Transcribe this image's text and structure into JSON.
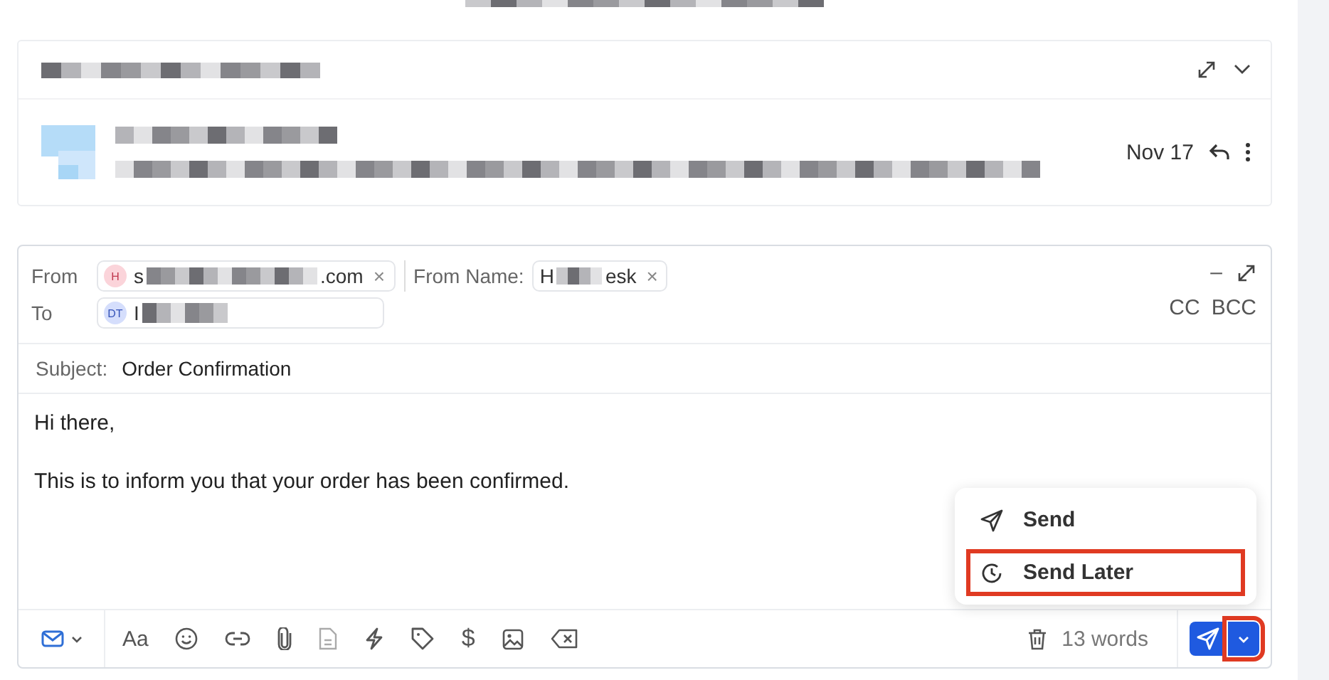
{
  "thread": {
    "date": "Nov 17"
  },
  "composer": {
    "from_label": "From",
    "from_chip": {
      "initials": "H",
      "text_start": "s",
      "text_end": ".com",
      "remove": "×"
    },
    "from_name_label": "From Name:",
    "from_name_chip": {
      "text_start": "H",
      "text_end": "esk",
      "remove": "×"
    },
    "to_label": "To",
    "to_chip": {
      "initials": "DT",
      "text_start": "I"
    },
    "cc": "CC",
    "bcc": "BCC",
    "minimize": "–",
    "subject_label": "Subject:",
    "subject": "Order Confirmation",
    "body": [
      "Hi there,",
      "This is to inform you that your order has been confirmed."
    ],
    "toolbar": {
      "format_label": "Aa",
      "currency_label": "$"
    },
    "word_count": "13 words",
    "send_menu": {
      "open": true,
      "items": [
        {
          "kind": "send",
          "label": "Send",
          "highlighted": false
        },
        {
          "kind": "later",
          "label": "Send Later",
          "highlighted": true
        }
      ]
    },
    "dropdown_highlighted": true
  }
}
